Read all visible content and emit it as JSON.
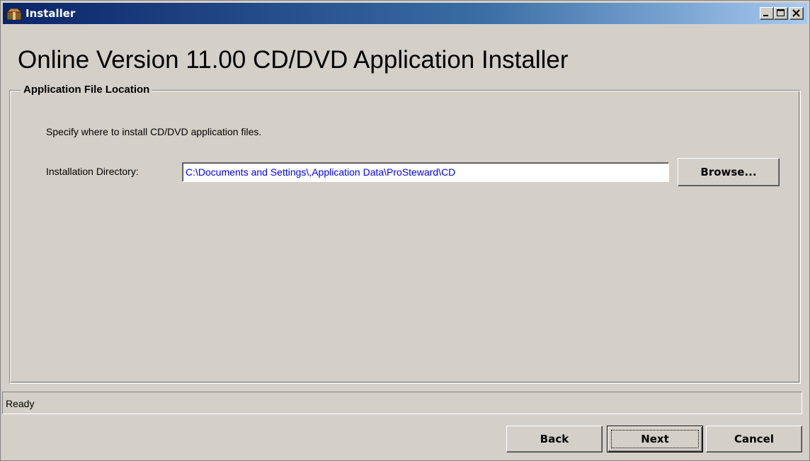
{
  "window": {
    "title": "Installer",
    "icon": "installer-box-icon",
    "controls": [
      "minimize-icon",
      "maximize-icon",
      "close-icon"
    ]
  },
  "header": {
    "title": "Online Version 11.00 CD/DVD Application Installer"
  },
  "group": {
    "title": "Application File Location",
    "instructions": "Specify where to install CD/DVD application files.",
    "directory_label": "Installation Directory:",
    "directory_value": "C:\\Documents and Settings\\,Application Data\\ProSteward\\CD",
    "browse_label": "Browse..."
  },
  "status": {
    "text": "Ready"
  },
  "buttons": {
    "back": "Back",
    "next": "Next",
    "cancel": "Cancel"
  },
  "colors": {
    "titlebar_start": "#0a246a",
    "titlebar_end": "#a6caf0",
    "face": "#d4d0c8",
    "input_text": "#0000ff"
  }
}
